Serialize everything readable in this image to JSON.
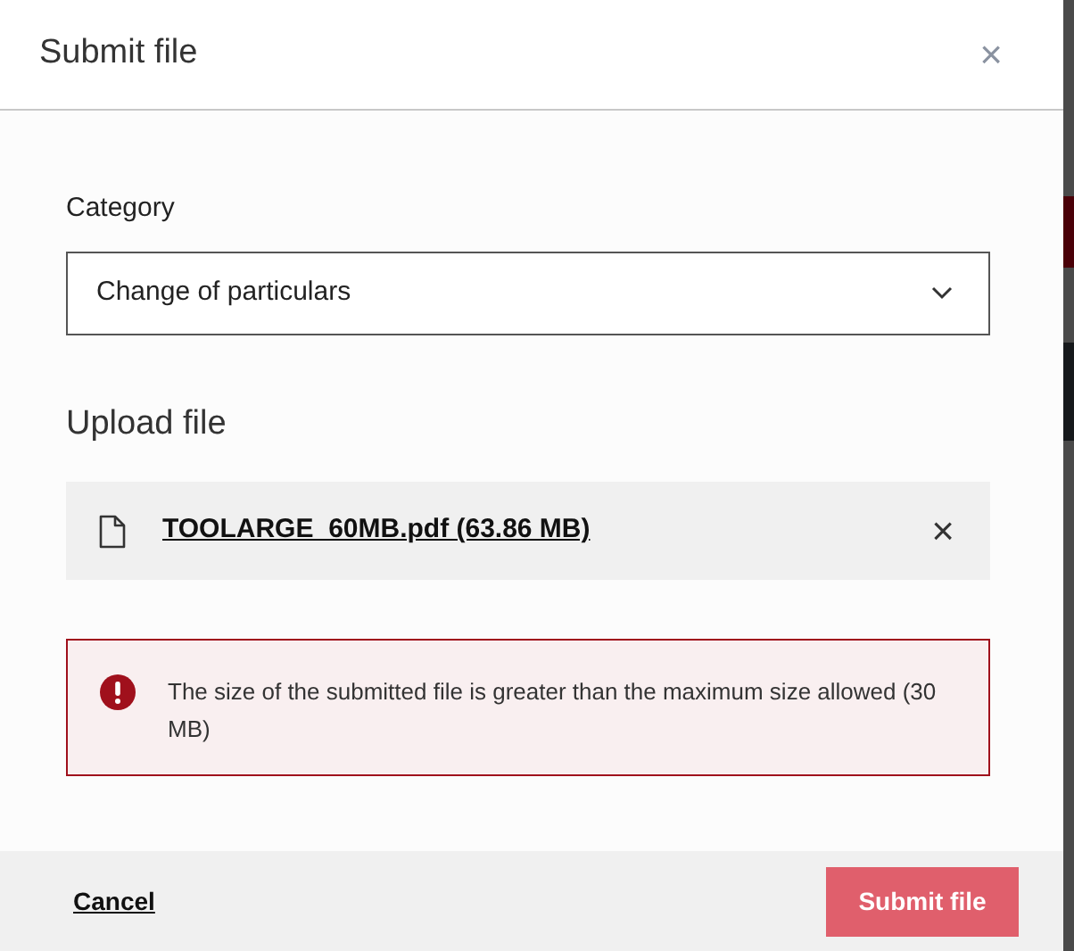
{
  "dialog": {
    "title": "Submit file",
    "close": "×"
  },
  "category": {
    "label": "Category",
    "value": "Change of particulars"
  },
  "upload": {
    "heading": "Upload file",
    "file": {
      "name": "TOOLARGE_60MB.pdf (63.86 MB)",
      "remove": "×"
    }
  },
  "error": {
    "message": "The size of the submitted file is greater than the maximum size allowed (30 MB)"
  },
  "footer": {
    "cancel": "Cancel",
    "submit": {
      "label": "Submit file",
      "disabled": true
    }
  }
}
